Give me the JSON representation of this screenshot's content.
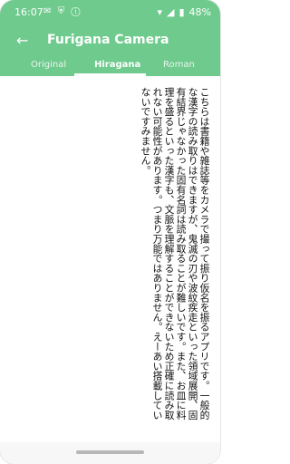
{
  "status": {
    "time": "16:07",
    "left_icons": [
      "message-icon",
      "shield-icon",
      "info-icon"
    ],
    "right_icons": [
      "wifi-icon",
      "signal-icon",
      "battery-icon"
    ],
    "battery": "48%"
  },
  "appbar": {
    "title": "Furigana Camera"
  },
  "tabs": [
    {
      "label": "Original",
      "active": false
    },
    {
      "label": "Hiragana",
      "active": true
    },
    {
      "label": "Roman",
      "active": false
    }
  ],
  "content": {
    "paragraph": "こちらは書籍や雑誌等をカメラで撮って振り仮名を振るアプリです。一般的な漢字の読み取りはできますが、鬼滅の刃や波紋疾走といった領域展開、固有結界じゃなかった固有名詞は読み取ることが難しいです。また、お皿に料理を盛るといった漢字も、文脈を理解することができないため正確に読み取れない可能性があります。つまり万能ではありません。えーあい搭載していないですみません。"
  },
  "colors": {
    "primary": "#6fca8d",
    "text": "#111111"
  }
}
